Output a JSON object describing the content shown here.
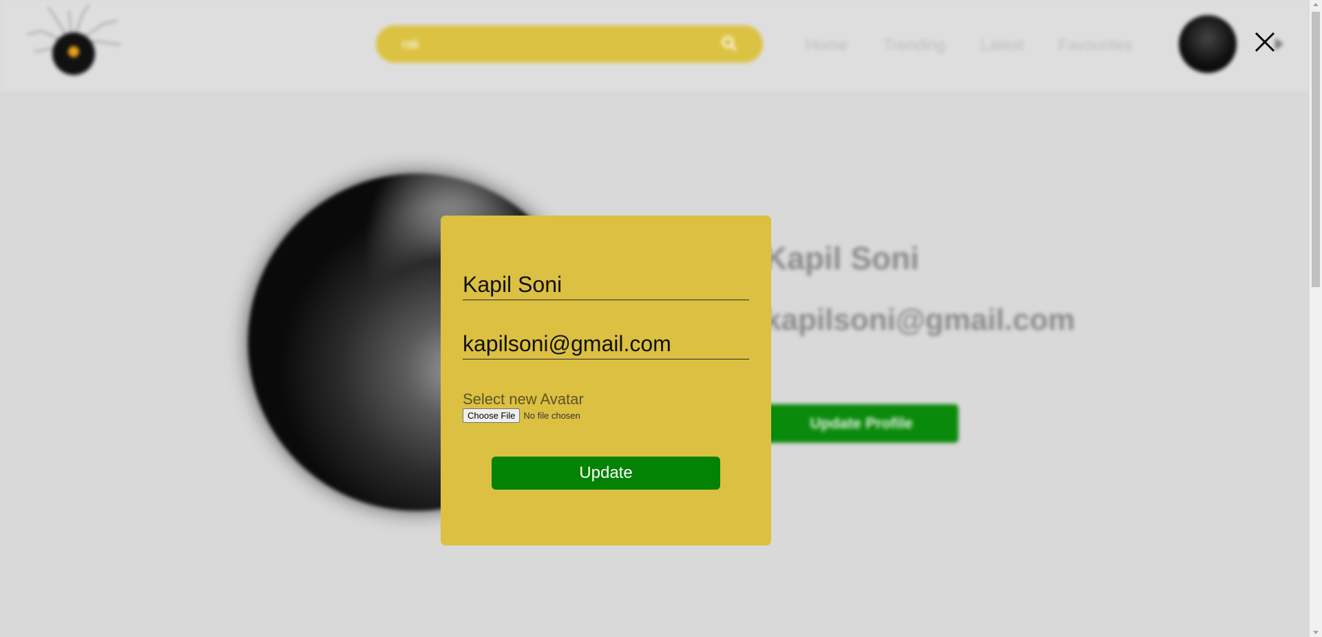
{
  "nav": {
    "search_value": "rak",
    "links": [
      "Home",
      "Trending",
      "Latest",
      "Favourites"
    ]
  },
  "profile": {
    "name": "Kapil Soni",
    "email": "kapilsoni@gmail.com",
    "update_profile_label": "Update Profile"
  },
  "modal": {
    "name_value": "Kapil Soni",
    "email_value": "kapilsoni@gmail.com",
    "avatar_label": "Select new Avatar",
    "choose_file_label": "Choose File",
    "file_status": "No file chosen",
    "update_label": "Update"
  },
  "colors": {
    "modal_bg": "#dbc042",
    "button_green": "#038203",
    "search_bg": "#dcc242"
  },
  "icons": {
    "close": "close-icon",
    "search": "search-icon"
  }
}
